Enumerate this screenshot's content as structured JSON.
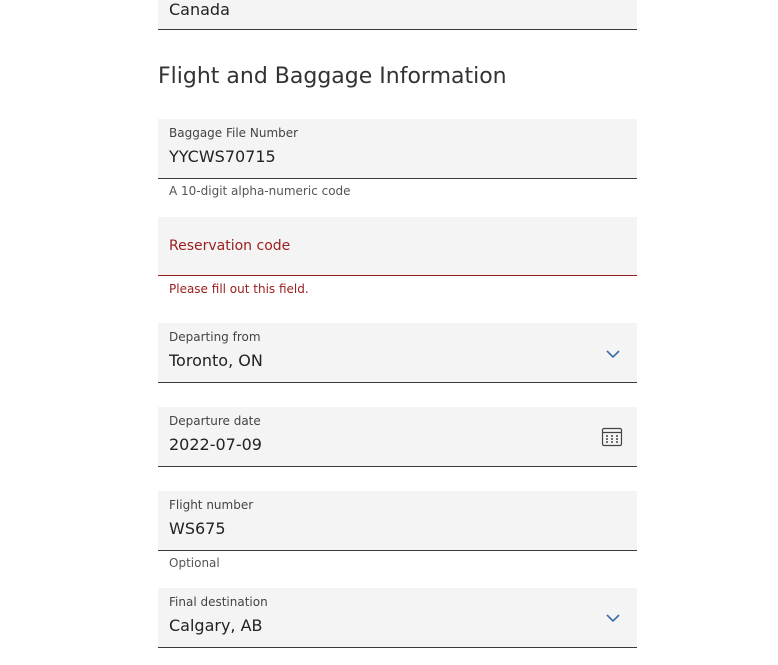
{
  "country": {
    "value": "Canada"
  },
  "section": {
    "title": "Flight and Baggage Information"
  },
  "baggage": {
    "label": "Baggage File Number",
    "value": "YYCWS70715",
    "helper": "A 10-digit alpha-numeric code"
  },
  "reservation": {
    "placeholder": "Reservation code",
    "error": "Please fill out this field."
  },
  "departing": {
    "label": "Departing from",
    "value": "Toronto, ON"
  },
  "departure_date": {
    "label": "Departure date",
    "value": "2022-07-09"
  },
  "flight": {
    "label": "Flight number",
    "value": "WS675",
    "helper": "Optional"
  },
  "destination": {
    "label": "Final destination",
    "value": "Calgary, AB"
  },
  "icons": {
    "dropdown": "chevron-down-icon",
    "calendar": "calendar-icon"
  },
  "colors": {
    "error": "#9b1c1c",
    "field_bg": "#f4f4f4",
    "accent": "#3c6ea8"
  }
}
